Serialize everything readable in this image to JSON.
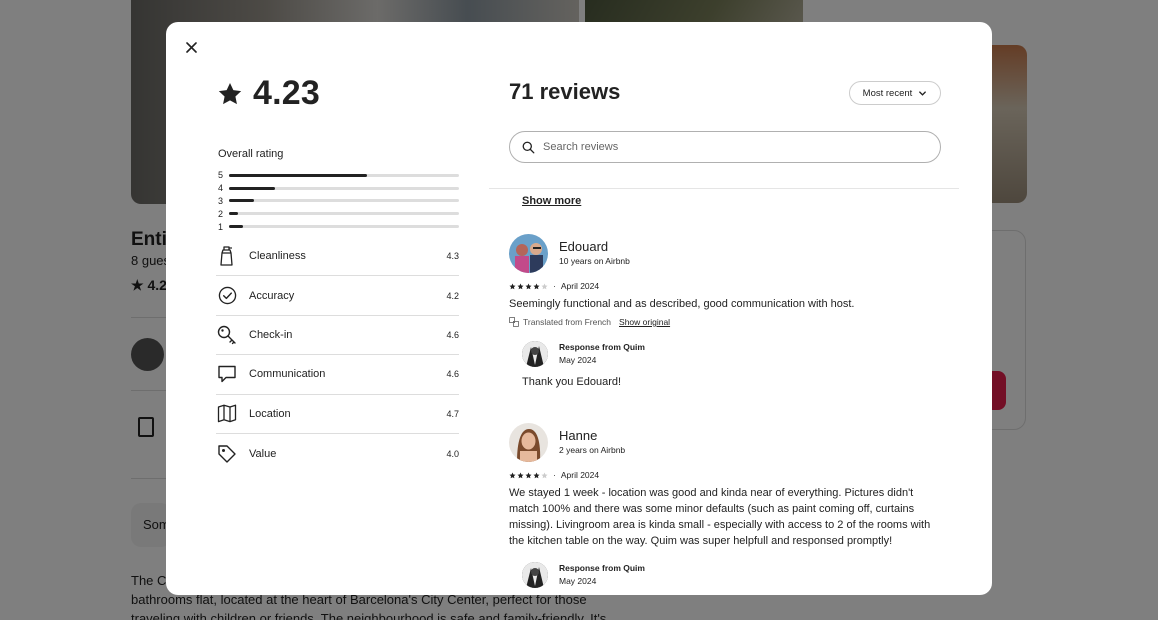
{
  "background": {
    "title": "Enti",
    "guests": "8 gues",
    "rating": "4.2",
    "some": "Som",
    "desc_line1": "The C",
    "desc_line2": "bathrooms flat, located at the heart of Barcelona's City Center, perfect for those",
    "desc_line3": "traveling with children or friends. The neighbourhood is safe and family-friendly. It's"
  },
  "modal": {
    "close_icon": "close-icon",
    "overall_score": "4.23",
    "overall_label": "Overall rating",
    "distribution": [
      {
        "label": "5",
        "fraction": 0.6
      },
      {
        "label": "4",
        "fraction": 0.2
      },
      {
        "label": "3",
        "fraction": 0.11
      },
      {
        "label": "2",
        "fraction": 0.04
      },
      {
        "label": "1",
        "fraction": 0.06
      }
    ],
    "categories": [
      {
        "name": "Cleanliness",
        "value": "4.3",
        "icon": "spray-bottle-icon"
      },
      {
        "name": "Accuracy",
        "value": "4.2",
        "icon": "check-circle-icon"
      },
      {
        "name": "Check-in",
        "value": "4.6",
        "icon": "key-icon"
      },
      {
        "name": "Communication",
        "value": "4.6",
        "icon": "message-icon"
      },
      {
        "name": "Location",
        "value": "4.7",
        "icon": "map-icon"
      },
      {
        "name": "Value",
        "value": "4.0",
        "icon": "tag-icon"
      }
    ],
    "reviews_title": "71 reviews",
    "sort_label": "Most recent",
    "search_placeholder": "Search reviews",
    "show_more": "Show more",
    "reviews": [
      {
        "name": "Edouard",
        "tenure": "10 years on Airbnb",
        "stars": 4,
        "date": "April 2024",
        "body": "Seemingly functional and as described, good communication with host.",
        "translated": "Translated from French",
        "show_original": "Show original",
        "response_title": "Response from Quim",
        "response_date": "May 2024",
        "response_body": "Thank you Edouard!"
      },
      {
        "name": "Hanne",
        "tenure": "2 years on Airbnb",
        "stars": 4,
        "date": "April 2024",
        "body": "We stayed 1 week - location was good and kinda near of everything. Pictures didn't match 100% and there was some minor defaults (such as paint coming off, curtains missing). Livingroom area is kinda small - especially with access to 2 of the rooms with the kitchen table on the way. Quim was super helpfull and responsed promptly!",
        "response_title": "Response from Quim",
        "response_date": "May 2024"
      }
    ]
  }
}
